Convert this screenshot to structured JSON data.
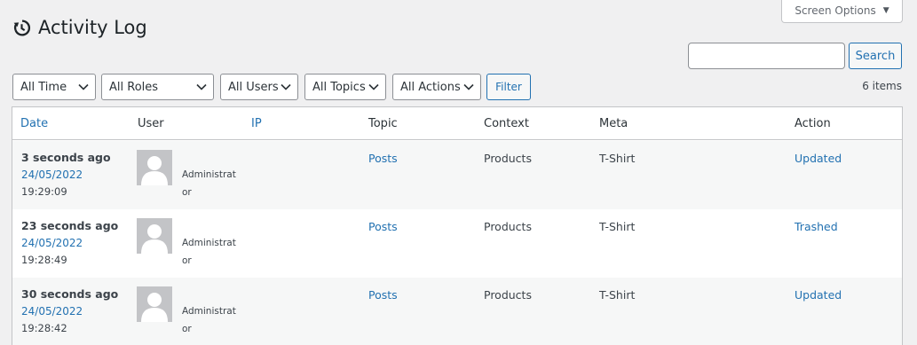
{
  "screen_options": {
    "label": "Screen Options",
    "caret": "▼"
  },
  "page": {
    "title": "Activity Log"
  },
  "search": {
    "placeholder": "",
    "value": "",
    "button_label": "Search"
  },
  "filters": {
    "time": "All Time",
    "roles": "All Roles",
    "users": "All Users",
    "topics": "All Topics",
    "actions": "All Actions",
    "filter_label": "Filter"
  },
  "items_count": "6 items",
  "table": {
    "columns": {
      "date": "Date",
      "user": "User",
      "ip": "IP",
      "topic": "Topic",
      "context": "Context",
      "meta": "Meta",
      "action": "Action"
    },
    "rows": [
      {
        "ago": "3 seconds ago",
        "date": "24/05/2022",
        "time": "19:29:09",
        "role_part1": "Administrat",
        "role_part2": "or",
        "topic": "Posts",
        "context": "Products",
        "meta": "T-Shirt",
        "action": "Updated"
      },
      {
        "ago": "23 seconds ago",
        "date": "24/05/2022",
        "time": "19:28:49",
        "role_part1": "Administrat",
        "role_part2": "or",
        "topic": "Posts",
        "context": "Products",
        "meta": "T-Shirt",
        "action": "Trashed"
      },
      {
        "ago": "30 seconds ago",
        "date": "24/05/2022",
        "time": "19:28:42",
        "role_part1": "Administrat",
        "role_part2": "or",
        "topic": "Posts",
        "context": "Products",
        "meta": "T-Shirt",
        "action": "Updated"
      }
    ]
  },
  "colors": {
    "link": "#2271b1",
    "background": "#f0f0f1",
    "alt_row": "#f6f7f7"
  }
}
